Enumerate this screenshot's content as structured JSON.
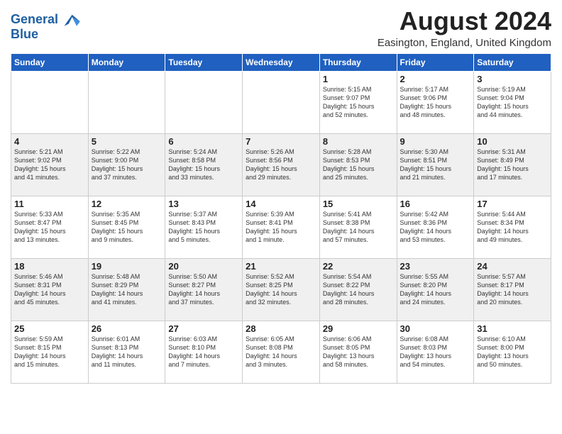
{
  "header": {
    "logo_line1": "General",
    "logo_line2": "Blue",
    "month_title": "August 2024",
    "location": "Easington, England, United Kingdom"
  },
  "days_of_week": [
    "Sunday",
    "Monday",
    "Tuesday",
    "Wednesday",
    "Thursday",
    "Friday",
    "Saturday"
  ],
  "weeks": [
    [
      {
        "day": "",
        "info": ""
      },
      {
        "day": "",
        "info": ""
      },
      {
        "day": "",
        "info": ""
      },
      {
        "day": "",
        "info": ""
      },
      {
        "day": "1",
        "info": "Sunrise: 5:15 AM\nSunset: 9:07 PM\nDaylight: 15 hours\nand 52 minutes."
      },
      {
        "day": "2",
        "info": "Sunrise: 5:17 AM\nSunset: 9:06 PM\nDaylight: 15 hours\nand 48 minutes."
      },
      {
        "day": "3",
        "info": "Sunrise: 5:19 AM\nSunset: 9:04 PM\nDaylight: 15 hours\nand 44 minutes."
      }
    ],
    [
      {
        "day": "4",
        "info": "Sunrise: 5:21 AM\nSunset: 9:02 PM\nDaylight: 15 hours\nand 41 minutes."
      },
      {
        "day": "5",
        "info": "Sunrise: 5:22 AM\nSunset: 9:00 PM\nDaylight: 15 hours\nand 37 minutes."
      },
      {
        "day": "6",
        "info": "Sunrise: 5:24 AM\nSunset: 8:58 PM\nDaylight: 15 hours\nand 33 minutes."
      },
      {
        "day": "7",
        "info": "Sunrise: 5:26 AM\nSunset: 8:56 PM\nDaylight: 15 hours\nand 29 minutes."
      },
      {
        "day": "8",
        "info": "Sunrise: 5:28 AM\nSunset: 8:53 PM\nDaylight: 15 hours\nand 25 minutes."
      },
      {
        "day": "9",
        "info": "Sunrise: 5:30 AM\nSunset: 8:51 PM\nDaylight: 15 hours\nand 21 minutes."
      },
      {
        "day": "10",
        "info": "Sunrise: 5:31 AM\nSunset: 8:49 PM\nDaylight: 15 hours\nand 17 minutes."
      }
    ],
    [
      {
        "day": "11",
        "info": "Sunrise: 5:33 AM\nSunset: 8:47 PM\nDaylight: 15 hours\nand 13 minutes."
      },
      {
        "day": "12",
        "info": "Sunrise: 5:35 AM\nSunset: 8:45 PM\nDaylight: 15 hours\nand 9 minutes."
      },
      {
        "day": "13",
        "info": "Sunrise: 5:37 AM\nSunset: 8:43 PM\nDaylight: 15 hours\nand 5 minutes."
      },
      {
        "day": "14",
        "info": "Sunrise: 5:39 AM\nSunset: 8:41 PM\nDaylight: 15 hours\nand 1 minute."
      },
      {
        "day": "15",
        "info": "Sunrise: 5:41 AM\nSunset: 8:38 PM\nDaylight: 14 hours\nand 57 minutes."
      },
      {
        "day": "16",
        "info": "Sunrise: 5:42 AM\nSunset: 8:36 PM\nDaylight: 14 hours\nand 53 minutes."
      },
      {
        "day": "17",
        "info": "Sunrise: 5:44 AM\nSunset: 8:34 PM\nDaylight: 14 hours\nand 49 minutes."
      }
    ],
    [
      {
        "day": "18",
        "info": "Sunrise: 5:46 AM\nSunset: 8:31 PM\nDaylight: 14 hours\nand 45 minutes."
      },
      {
        "day": "19",
        "info": "Sunrise: 5:48 AM\nSunset: 8:29 PM\nDaylight: 14 hours\nand 41 minutes."
      },
      {
        "day": "20",
        "info": "Sunrise: 5:50 AM\nSunset: 8:27 PM\nDaylight: 14 hours\nand 37 minutes."
      },
      {
        "day": "21",
        "info": "Sunrise: 5:52 AM\nSunset: 8:25 PM\nDaylight: 14 hours\nand 32 minutes."
      },
      {
        "day": "22",
        "info": "Sunrise: 5:54 AM\nSunset: 8:22 PM\nDaylight: 14 hours\nand 28 minutes."
      },
      {
        "day": "23",
        "info": "Sunrise: 5:55 AM\nSunset: 8:20 PM\nDaylight: 14 hours\nand 24 minutes."
      },
      {
        "day": "24",
        "info": "Sunrise: 5:57 AM\nSunset: 8:17 PM\nDaylight: 14 hours\nand 20 minutes."
      }
    ],
    [
      {
        "day": "25",
        "info": "Sunrise: 5:59 AM\nSunset: 8:15 PM\nDaylight: 14 hours\nand 15 minutes."
      },
      {
        "day": "26",
        "info": "Sunrise: 6:01 AM\nSunset: 8:13 PM\nDaylight: 14 hours\nand 11 minutes."
      },
      {
        "day": "27",
        "info": "Sunrise: 6:03 AM\nSunset: 8:10 PM\nDaylight: 14 hours\nand 7 minutes."
      },
      {
        "day": "28",
        "info": "Sunrise: 6:05 AM\nSunset: 8:08 PM\nDaylight: 14 hours\nand 3 minutes."
      },
      {
        "day": "29",
        "info": "Sunrise: 6:06 AM\nSunset: 8:05 PM\nDaylight: 13 hours\nand 58 minutes."
      },
      {
        "day": "30",
        "info": "Sunrise: 6:08 AM\nSunset: 8:03 PM\nDaylight: 13 hours\nand 54 minutes."
      },
      {
        "day": "31",
        "info": "Sunrise: 6:10 AM\nSunset: 8:00 PM\nDaylight: 13 hours\nand 50 minutes."
      }
    ]
  ]
}
